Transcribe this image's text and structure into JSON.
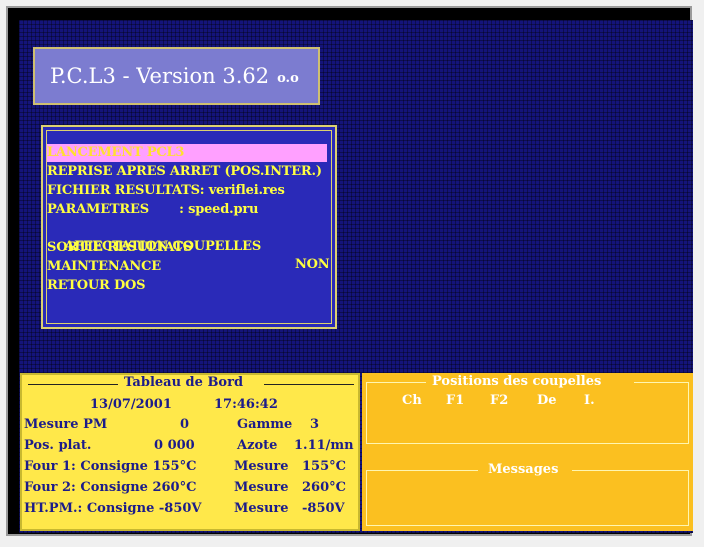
{
  "title": {
    "main": "P.C.L3 - Version 3.62",
    "suffix": "o.o"
  },
  "menu": {
    "items": [
      {
        "label": "LANCEMENT PCL3",
        "value": ""
      },
      {
        "label": "REPRISE APRES ARRET (POS.INTER.)",
        "value": ""
      },
      {
        "label": "FICHIER RESULTATS: veriflei.res",
        "value": ""
      },
      {
        "label": "PARAMETRES       : speed.pru",
        "value": ""
      },
      {
        "label": "AFFECTATION COUPELLES",
        "value": "NON"
      },
      {
        "label": "SORTIE RESULTATS",
        "value": ""
      },
      {
        "label": "MAINTENANCE",
        "value": ""
      },
      {
        "label": "RETOUR DOS",
        "value": ""
      }
    ]
  },
  "tableau": {
    "title": "Tableau de Bord",
    "date": "13/07/2001",
    "time": "17:46:42",
    "rows": [
      {
        "a": "Mesure PM",
        "b": "0",
        "c": "Gamme",
        "d": "3"
      },
      {
        "a": "Pos. plat.",
        "b": "0 000",
        "c": "Azote",
        "d": "1.11/mn"
      },
      {
        "a": "Four 1: Consigne 155°C",
        "c": "Mesure",
        "d": "155°C"
      },
      {
        "a": "Four 2: Consigne 260°C",
        "c": "Mesure",
        "d": "260°C"
      },
      {
        "a": "HT.PM.: Consigne -850V",
        "c": "Mesure",
        "d": "-850V"
      }
    ]
  },
  "positions": {
    "title": "Positions des coupelles",
    "cols": [
      "Ch",
      "F1",
      "F2",
      "De",
      "I."
    ]
  },
  "messages": {
    "title": "Messages"
  }
}
